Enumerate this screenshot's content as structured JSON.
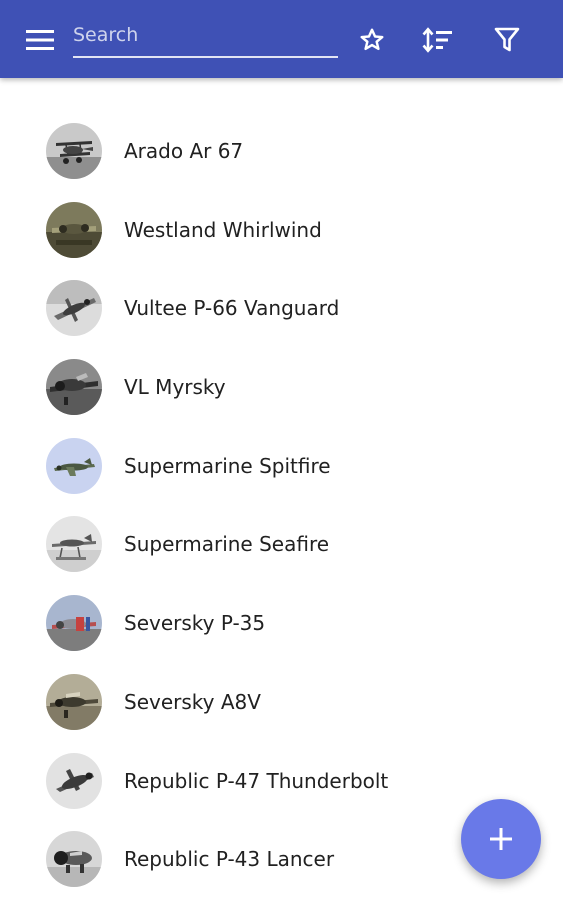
{
  "toolbar": {
    "menu_icon": "menu-icon",
    "search": {
      "value": "",
      "placeholder": "Search"
    },
    "favorites_icon": "star-outline-icon",
    "sort_icon": "sort-icon",
    "filter_icon": "filter-icon",
    "background_color": "#3f51b5"
  },
  "aircraft": [
    {
      "name": "Arado Ar 67",
      "thumb": "grey-biplane"
    },
    {
      "name": "Westland Whirlwind",
      "thumb": "olive-photo"
    },
    {
      "name": "Vultee P-66 Vanguard",
      "thumb": "grey-sky"
    },
    {
      "name": "VL Myrsky",
      "thumb": "dark-grey"
    },
    {
      "name": "Supermarine Spitfire",
      "thumb": "blue-sky-camo"
    },
    {
      "name": "Supermarine Seafire",
      "thumb": "light-grey"
    },
    {
      "name": "Seversky P-35",
      "thumb": "blue-sky-red"
    },
    {
      "name": "Seversky A8V",
      "thumb": "olive-grey"
    },
    {
      "name": "Republic P-47 Thunderbolt",
      "thumb": "light-grey-sky"
    },
    {
      "name": "Republic P-43 Lancer",
      "thumb": "dark-nose"
    }
  ],
  "fab": {
    "icon": "plus-icon",
    "color": "#6979e8"
  }
}
